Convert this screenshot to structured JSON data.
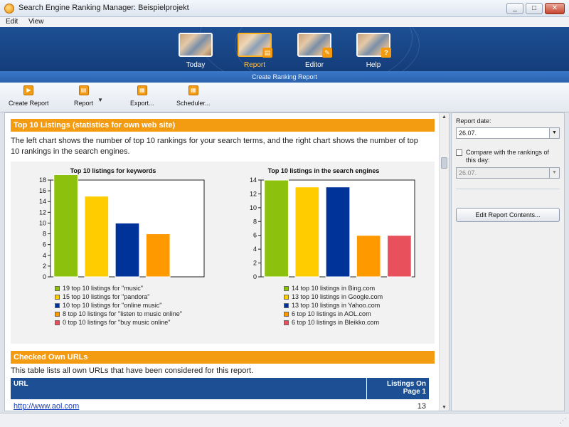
{
  "window": {
    "title": "Search Engine Ranking Manager: Beispielprojekt"
  },
  "menu": [
    {
      "label": "Edit"
    },
    {
      "label": "View"
    }
  ],
  "nav": [
    {
      "label": "Today",
      "active": false,
      "icon": "people-photo-icon"
    },
    {
      "label": "Report",
      "active": true,
      "icon": "report-icon"
    },
    {
      "label": "Editor",
      "active": false,
      "icon": "editor-icon"
    },
    {
      "label": "Help",
      "active": false,
      "icon": "help-icon"
    }
  ],
  "subtitle": "Create Ranking Report",
  "toolbar": [
    {
      "label": "Create Report",
      "icon": "play-icon"
    },
    {
      "label": "Report",
      "icon": "report-icon"
    },
    {
      "label": "Export...",
      "icon": "export-icon"
    },
    {
      "label": "Scheduler...",
      "icon": "calendar-icon"
    }
  ],
  "section1": {
    "title": "Top 10 Listings (statistics for own web site)",
    "description": "The left chart shows the number of top 10 rankings for your search terms, and the right chart shows the number of top 10 rankings in the search engines."
  },
  "chart_data": [
    {
      "type": "bar",
      "title": "Top 10 listings for keywords",
      "categories": [
        "music",
        "pandora",
        "online music",
        "listen to music online",
        "buy music online"
      ],
      "values": [
        19,
        15,
        10,
        8,
        0
      ],
      "colors": [
        "#8cc10e",
        "#ffcc00",
        "#003399",
        "#ff9900",
        "#e8505b"
      ],
      "legend": [
        "19 top 10 listings for \"music\"",
        "15 top 10 listings for \"pandora\"",
        "10 top 10 listings for \"online music\"",
        "8 top 10 listings for \"listen to music online\"",
        "0 top 10 listings for \"buy music online\""
      ],
      "yticks": [
        0,
        2,
        4,
        6,
        8,
        10,
        12,
        14,
        16,
        18
      ],
      "ylim": [
        0,
        18
      ],
      "grid": false
    },
    {
      "type": "bar",
      "title": "Top 10 listings in the search engines",
      "categories": [
        "Bing.com",
        "Google.com",
        "Yahoo.com",
        "AOL.com",
        "Bleikko.com"
      ],
      "values": [
        14,
        13,
        13,
        6,
        6
      ],
      "colors": [
        "#8cc10e",
        "#ffcc00",
        "#003399",
        "#ff9900",
        "#e8505b"
      ],
      "legend": [
        "14 top 10 listings in Bing.com",
        "13 top 10 listings in Google.com",
        "13 top 10 listings in Yahoo.com",
        "6 top 10 listings in AOL.com",
        "6 top 10 listings in Bleikko.com"
      ],
      "yticks": [
        0,
        2,
        4,
        6,
        8,
        10,
        12,
        14
      ],
      "ylim": [
        0,
        14
      ],
      "grid": false
    }
  ],
  "section2": {
    "title": "Checked Own URLs",
    "description": "This table lists all own URLs that have been considered for this report.",
    "columns": [
      "URL",
      "Listings On Page 1"
    ],
    "rows": [
      {
        "url": "http://www.aol.com",
        "listings": "13"
      }
    ]
  },
  "side": {
    "report_date_label": "Report date:",
    "report_date_value": "26.07.",
    "compare_label": "Compare with the rankings of this day:",
    "compare_checked": false,
    "compare_value": "26.07.",
    "edit_button": "Edit Report Contents..."
  },
  "colors": {
    "accent": "#f39c12",
    "header_blue": "#1d4f94"
  }
}
